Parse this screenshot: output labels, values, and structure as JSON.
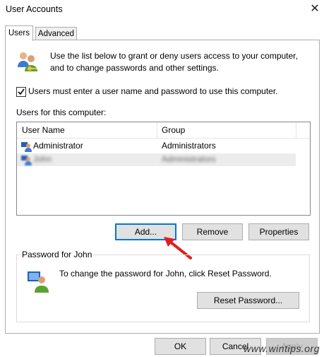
{
  "window": {
    "title": "User Accounts",
    "close_glyph": "✕"
  },
  "tabs": [
    {
      "label": "Users",
      "active": true
    },
    {
      "label": "Advanced",
      "active": false
    }
  ],
  "intro": {
    "icon": "users-group-icon",
    "line1": "Use the list below to grant or deny users access to your computer,",
    "line2": "and to change passwords and other settings."
  },
  "require_login": {
    "checked": true,
    "label": "Users must enter a user name and password to use this computer."
  },
  "users_list": {
    "label": "Users for this computer:",
    "columns": [
      "User Name",
      "Group"
    ],
    "rows": [
      {
        "name": "Administrator",
        "group": "Administrators",
        "blurred": false
      },
      {
        "name": "John",
        "group": "Administrators",
        "blurred": true
      }
    ]
  },
  "buttons": {
    "add": "Add...",
    "remove": "Remove",
    "properties": "Properties"
  },
  "password_group": {
    "title": "Password for John",
    "text": "To change the password for John, click Reset Password.",
    "reset_button": "Reset Password..."
  },
  "footer": {
    "ok": "OK",
    "cancel": "Cancel",
    "apply": "Apply"
  },
  "watermark": "www.wintips.org",
  "colors": {
    "accent_border": "#0078d7",
    "arrow": "#e02020"
  }
}
